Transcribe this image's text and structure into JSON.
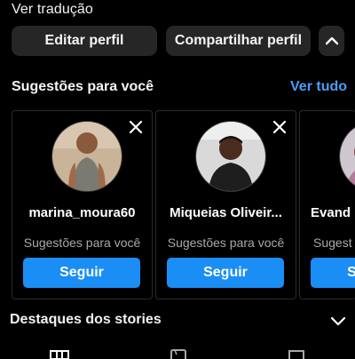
{
  "profile": {
    "translate_link": "Ver tradução",
    "edit_button": "Editar perfil",
    "share_button": "Compartilhar perfil"
  },
  "suggestions": {
    "title": "Sugestões para você",
    "see_all": "Ver tudo",
    "cards": [
      {
        "name": "marina_moura60",
        "subtitle": "Sugestões para você",
        "follow": "Seguir"
      },
      {
        "name": "Miqueias Oliveir...",
        "subtitle": "Sugestões para você",
        "follow": "Seguir"
      },
      {
        "name": "Evand",
        "subtitle": "Sugest",
        "follow": "Seguir"
      }
    ]
  },
  "highlights": {
    "title": "Destaques dos stories"
  },
  "colors": {
    "background": "#000000",
    "button_dark": "#262626",
    "follow_blue": "#1a8ef5",
    "link_blue": "#4a9df8",
    "muted_text": "#a8a8a8"
  },
  "icons": [
    "close-icon",
    "chevron-up-icon",
    "chevron-down-icon",
    "grid-icon",
    "reels-icon",
    "tagged-icon"
  ]
}
